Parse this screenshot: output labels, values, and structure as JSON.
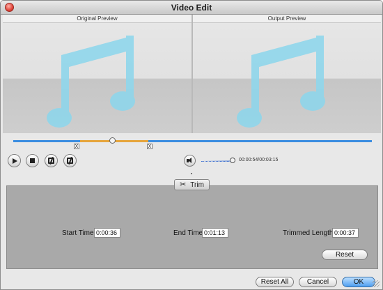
{
  "window": {
    "title": "Video Edit"
  },
  "preview": {
    "left_label": "Original Preview",
    "right_label": "Output Preview",
    "content_icon": "music-note-icon"
  },
  "player": {
    "time_display": "00:00:54/00:03:15",
    "volume_level": 1.0,
    "playhead_position": 0.27,
    "selection_start": 0.19,
    "selection_end": 0.38,
    "trim_marker_glyph": "X"
  },
  "trim": {
    "tab_label": "Trim",
    "start_time_label": "Start Time",
    "start_time_value": "0:00:36",
    "end_time_label": "End Time",
    "end_time_value": "0:01:13",
    "trimmed_length_label": "Trimmed Length",
    "trimmed_length_value": "0:00:37",
    "reset_label": "Reset"
  },
  "footer": {
    "reset_all_label": "Reset All",
    "cancel_label": "Cancel",
    "ok_label": "OK"
  },
  "colors": {
    "timeline": "#3b8de0",
    "selection": "#e6a53c",
    "note": "#8fd6eb",
    "panel": "#a9a9a9"
  }
}
